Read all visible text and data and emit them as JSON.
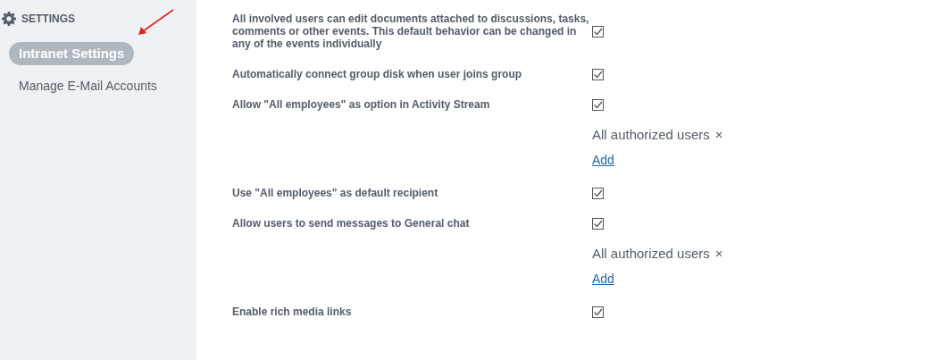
{
  "sidebar": {
    "heading": "SETTINGS",
    "items": [
      {
        "label": "Intranet Settings",
        "selected": true
      },
      {
        "label": "Manage E-Mail Accounts",
        "selected": false
      }
    ]
  },
  "settings": [
    {
      "kind": "checkbox",
      "label": "All involved users can edit documents attached to discussions, tasks, comments or other events. This default behavior can be changed in any of the events individually",
      "checked": true
    },
    {
      "kind": "checkbox",
      "label": "Automatically connect group disk when user joins group",
      "checked": true
    },
    {
      "kind": "checkbox",
      "label": "Allow \"All employees\" as option in Activity Stream",
      "checked": true
    },
    {
      "kind": "access",
      "tag": "All authorized users",
      "remove": "×",
      "add": "Add"
    },
    {
      "kind": "checkbox",
      "label": "Use \"All employees\" as default recipient",
      "checked": true
    },
    {
      "kind": "checkbox",
      "label": "Allow users to send messages to General chat",
      "checked": true
    },
    {
      "kind": "access",
      "tag": "All authorized users",
      "remove": "×",
      "add": "Add"
    },
    {
      "kind": "checkbox",
      "label": "Enable rich media links",
      "checked": true
    }
  ]
}
